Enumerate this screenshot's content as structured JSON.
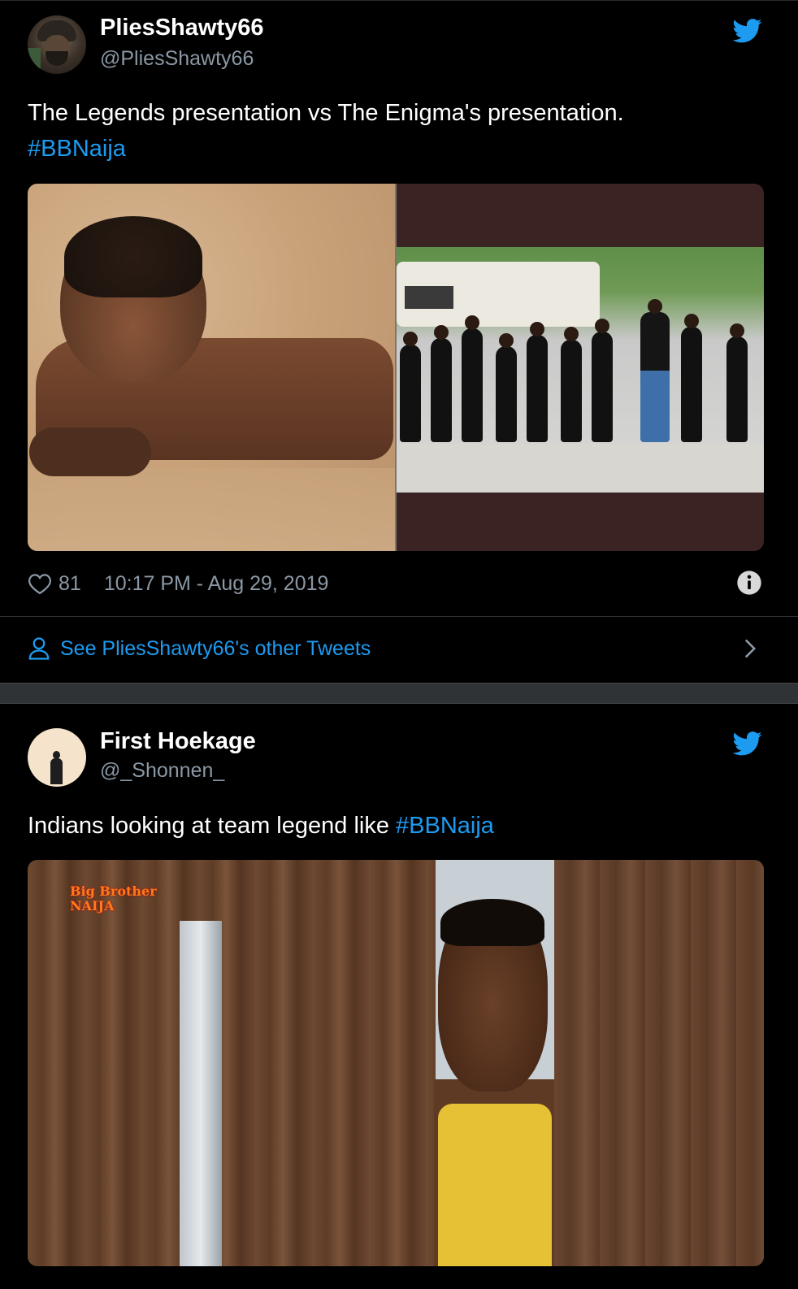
{
  "colors": {
    "background": "#000000",
    "link_blue": "#1d9bf0",
    "secondary_text": "#8b98a5",
    "separator": "#2f3336"
  },
  "tweets": [
    {
      "display_name": "PliesShawty66",
      "handle": "@PliesShawty66",
      "text_main": "The Legends presentation vs The Enigma's presentation.",
      "hashtag": "#BBNaija",
      "icon": "twitter-bird-icon",
      "likes": "81",
      "timestamp": "10:17 PM - Aug 29, 2019",
      "see_more_label": "See PliesShawty66's other Tweets"
    },
    {
      "display_name": "First Hoekage",
      "handle": "@_Shonnen_",
      "text_main": "Indians looking at team legend like ",
      "hashtag": "#BBNaija",
      "icon": "twitter-bird-icon",
      "media_logo_line1": "Big Brother",
      "media_logo_line2": "NAIJA"
    }
  ]
}
